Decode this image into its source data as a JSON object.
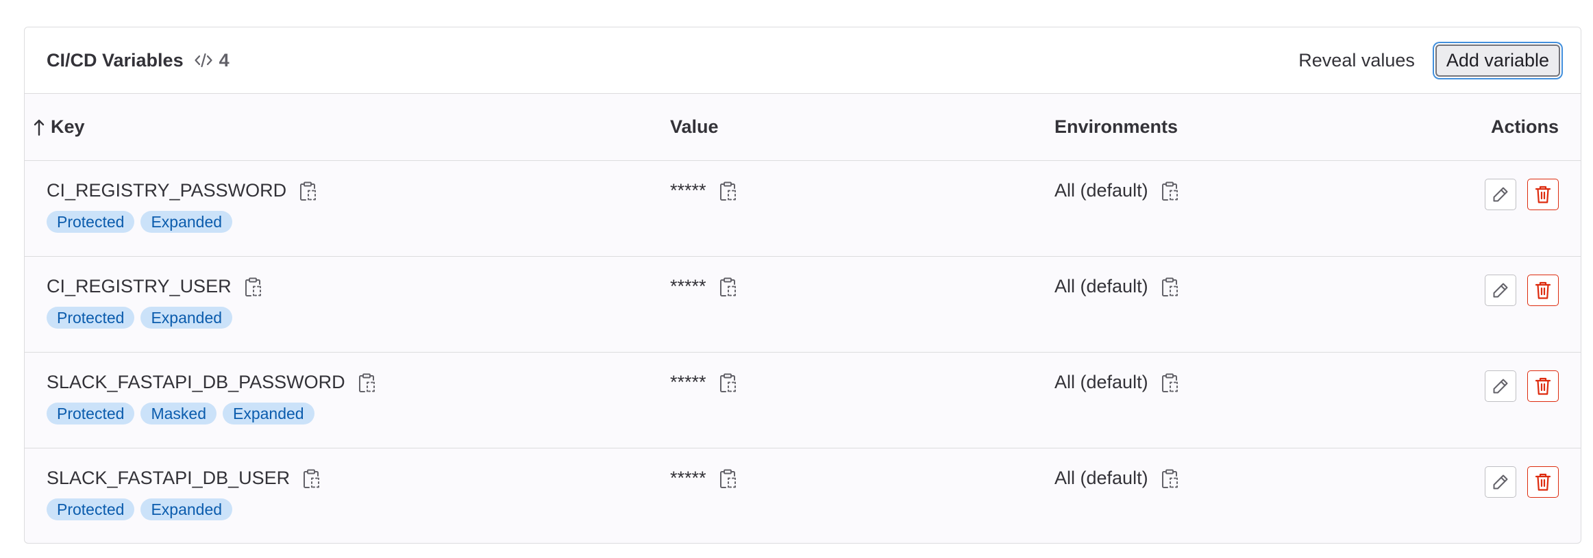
{
  "header": {
    "title": "CI/CD Variables",
    "count": "4",
    "reveal_label": "Reveal values",
    "add_label": "Add variable"
  },
  "columns": {
    "key": "Key",
    "value": "Value",
    "environments": "Environments",
    "actions": "Actions"
  },
  "rows": [
    {
      "key": "CI_REGISTRY_PASSWORD",
      "value": "*****",
      "environment": "All (default)",
      "badges": [
        "Protected",
        "Expanded"
      ]
    },
    {
      "key": "CI_REGISTRY_USER",
      "value": "*****",
      "environment": "All (default)",
      "badges": [
        "Protected",
        "Expanded"
      ]
    },
    {
      "key": "SLACK_FASTAPI_DB_PASSWORD",
      "value": "*****",
      "environment": "All (default)",
      "badges": [
        "Protected",
        "Masked",
        "Expanded"
      ]
    },
    {
      "key": "SLACK_FASTAPI_DB_USER",
      "value": "*****",
      "environment": "All (default)",
      "badges": [
        "Protected",
        "Expanded"
      ]
    }
  ],
  "icons": {
    "count": "code-icon",
    "sort": "arrow-up-icon",
    "copy": "copy-to-clipboard-icon",
    "edit": "pencil-icon",
    "delete": "trash-icon"
  },
  "colors": {
    "badge_bg": "#cbe2f9",
    "badge_text": "#0b5cad",
    "danger": "#dd2b0e",
    "focus_ring": "#428fdc"
  }
}
